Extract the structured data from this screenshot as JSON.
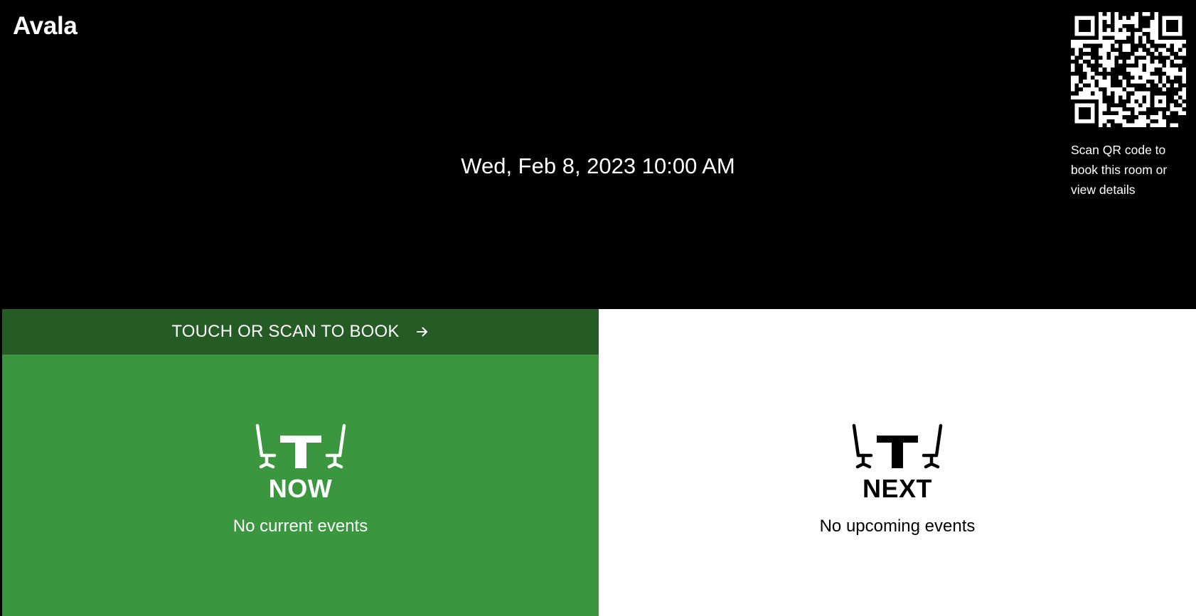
{
  "header": {
    "room_name": "Avala",
    "datetime": "Wed, Feb 8, 2023 10:00 AM",
    "qr_text": "Scan QR code to book this room or view details"
  },
  "book_bar": {
    "label": "TOUCH OR SCAN TO BOOK",
    "icon": "arrow-right-icon"
  },
  "now": {
    "icon": "meeting-room-icon",
    "label": "NOW",
    "text": "No current events"
  },
  "next": {
    "icon": "meeting-room-icon",
    "label": "NEXT",
    "text": "No upcoming events"
  },
  "colors": {
    "header_bg": "#000000",
    "available_green": "#3a963f",
    "book_bar_green": "#255b25",
    "next_bg": "#ffffff"
  }
}
